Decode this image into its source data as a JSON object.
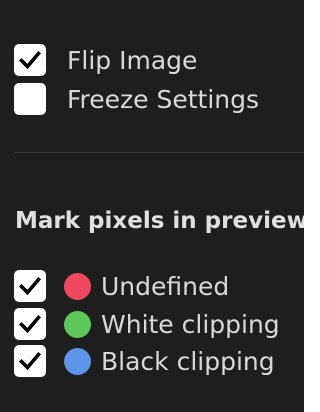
{
  "options": {
    "flip_image": {
      "label": "Flip Image",
      "checked": true
    },
    "freeze_settings": {
      "label": "Freeze Settings",
      "checked": false
    }
  },
  "mark_pixels": {
    "title": "Mark pixels in preview",
    "items": [
      {
        "label": "Undefined",
        "checked": true,
        "color": "#f0485f"
      },
      {
        "label": "White clipping",
        "checked": true,
        "color": "#5cc85c"
      },
      {
        "label": "Black clipping",
        "checked": true,
        "color": "#5b96e8"
      }
    ]
  }
}
